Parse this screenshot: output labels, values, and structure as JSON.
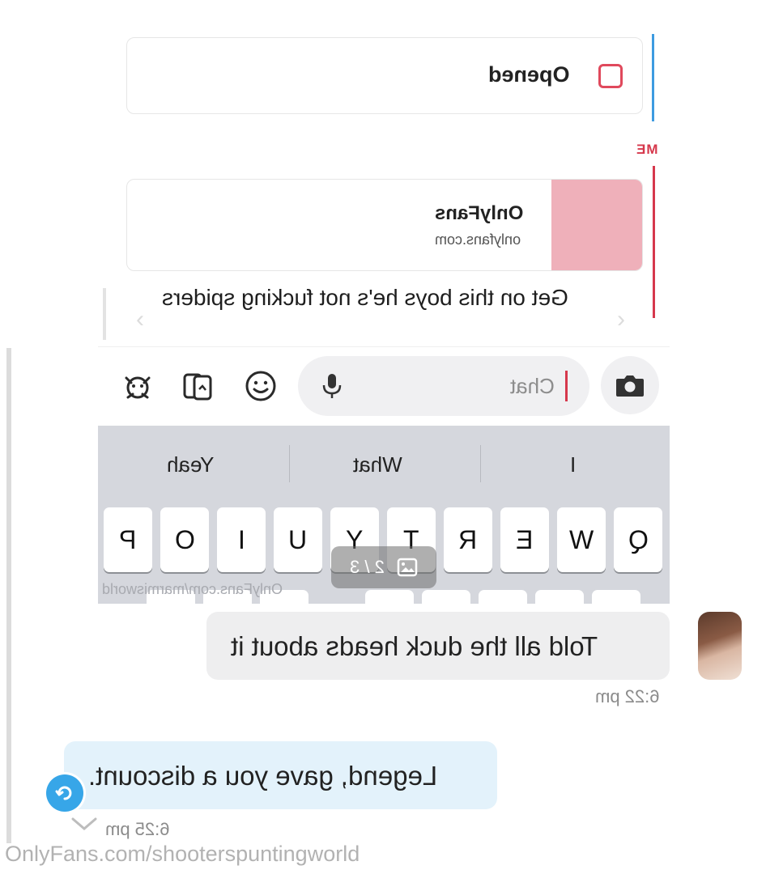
{
  "snap_screenshot": {
    "opened_label": "Opened",
    "sender_label": "ME",
    "link_card": {
      "site_name": "OnlyFans",
      "site_url": "onlyfans.com"
    },
    "message": "Get on this boys he's not fucking spiders",
    "chat_placeholder": "Chat",
    "suggestions": [
      "I",
      "What",
      "Yeah"
    ],
    "keys": [
      "Q",
      "W",
      "E",
      "R",
      "T",
      "Y",
      "U",
      "I",
      "O",
      "P"
    ],
    "image_counter": "2 / 3",
    "inner_watermark": "OnlyFans.com/marmisworld",
    "icons": {
      "camera": "camera-icon",
      "mic": "mic-icon",
      "emoji": "smile-icon",
      "stickers": "cards-icon",
      "bitmoji": "bitmoji-icon"
    }
  },
  "chat": {
    "messages": [
      {
        "sender": "them",
        "text": "Told all the duck heads about it",
        "time": "6:22 pm"
      },
      {
        "sender": "me",
        "text": "Legend, gave you a discount.",
        "time": "6:25 pm"
      }
    ]
  },
  "watermark": "OnlyFans.com/shooterspuntingworld",
  "colors": {
    "snap_red": "#d6384c",
    "snap_blue": "#3d9be0",
    "my_bubble": "#e3f2fb",
    "their_bubble": "#eeeeef",
    "read_badge": "#37a6e8"
  }
}
